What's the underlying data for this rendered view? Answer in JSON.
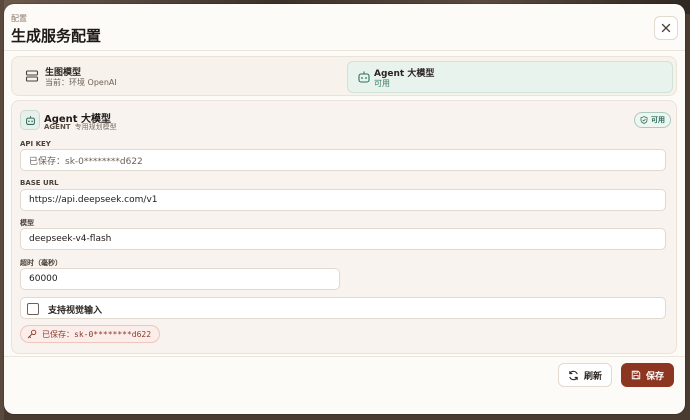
{
  "header": {
    "eyebrow": "配置",
    "title": "生成服务配置"
  },
  "tabs": [
    {
      "name": "生图模型",
      "subtitle": "当前：环境 OpenAI",
      "icon": "server-icon",
      "selected": false
    },
    {
      "name": "Agent 大模型",
      "subtitle": "可用",
      "icon": "bot-icon",
      "selected": true
    }
  ],
  "panel": {
    "icon": "bot-icon",
    "title": "Agent 大模型",
    "tag": "AGENT",
    "subtitle": "专用规划模型",
    "status": "可用"
  },
  "fields": {
    "api_key": {
      "label": "API KEY",
      "placeholder": "已保存：sk-0********d622"
    },
    "base_url": {
      "label": "BASE URL",
      "value": "https://api.deepseek.com/v1"
    },
    "model": {
      "label": "模型",
      "value": "deepseek-v4-flash"
    },
    "timeout": {
      "label": "超时（毫秒）",
      "value": "60000"
    },
    "vision": {
      "label": "支持视觉输入",
      "checked": false
    }
  },
  "saved_key": "已保存：sk-0********d622",
  "actions": {
    "refresh": "刷新",
    "save": "保存"
  },
  "colors": {
    "accent": "#8c3520",
    "success": "#2f6f5c",
    "selected_tab_bg": "#e9f3ee"
  }
}
